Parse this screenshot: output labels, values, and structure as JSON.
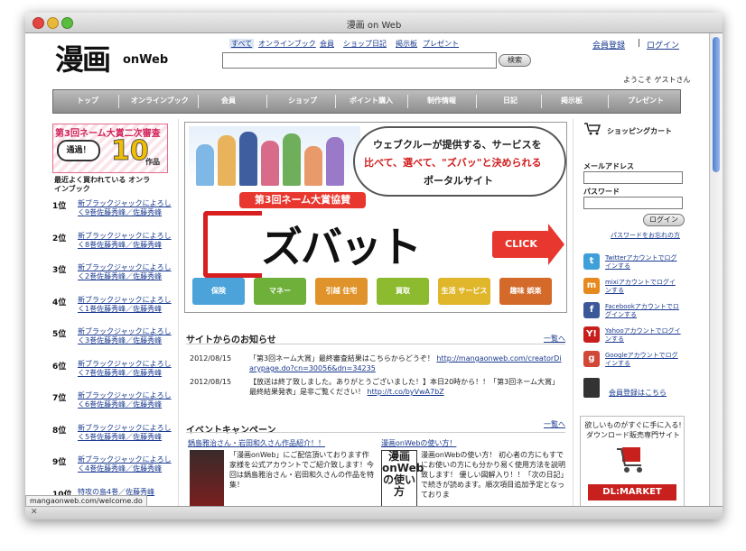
{
  "window": {
    "title": "漫画 on Web"
  },
  "status": {
    "url": "mangaonweb.com/welcome.do"
  },
  "header": {
    "logo_main": "漫画",
    "logo_sub": "onWeb",
    "search_tabs": [
      "すべて",
      "オンラインブック",
      "会員",
      "ショップ",
      "日記",
      "掲示板",
      "プレゼント"
    ],
    "search_button": "検索",
    "search_value": "",
    "member_register": "会員登録",
    "separator": "|",
    "login": "ログイン",
    "welcome": "ようこそ ゲストさん"
  },
  "nav": {
    "items": [
      "トップ",
      "オンラインブック",
      "会員",
      "ショップ",
      "ポイント購入",
      "制作情報",
      "日記",
      "掲示板",
      "プレゼント"
    ]
  },
  "left": {
    "contest_title": "第3回ネーム大賞二次審査",
    "pass_label": "通過！",
    "pass_count": "10",
    "pass_unit": "作品",
    "popular_label": "最近よく買われている オンラインブック",
    "ranking": [
      {
        "rank": "1位",
        "title": "新ブラックジャックによろしく9巻",
        "author": "佐藤秀峰／佐藤秀峰"
      },
      {
        "rank": "2位",
        "title": "新ブラックジャックによろしく8巻",
        "author": "佐藤秀峰／佐藤秀峰"
      },
      {
        "rank": "3位",
        "title": "新ブラックジャックによろしく2巻",
        "author": "佐藤秀峰／佐藤秀峰"
      },
      {
        "rank": "4位",
        "title": "新ブラックジャックによろしく1巻",
        "author": "佐藤秀峰／佐藤秀峰"
      },
      {
        "rank": "5位",
        "title": "新ブラックジャックによろしく3巻",
        "author": "佐藤秀峰／佐藤秀峰"
      },
      {
        "rank": "6位",
        "title": "新ブラックジャックによろしく7巻",
        "author": "佐藤秀峰／佐藤秀峰"
      },
      {
        "rank": "7位",
        "title": "新ブラックジャックによろしく6巻",
        "author": "佐藤秀峰／佐藤秀峰"
      },
      {
        "rank": "8位",
        "title": "新ブラックジャックによろしく5巻",
        "author": "佐藤秀峰／佐藤秀峰"
      },
      {
        "rank": "9位",
        "title": "新ブラックジャックによろしく4巻",
        "author": "佐藤秀峰／佐藤秀峰"
      },
      {
        "rank": "10位",
        "title": "特攻の島4巻／佐藤秀峰",
        "author": ""
      }
    ]
  },
  "banner": {
    "line1": "ウェブクルーが提供する、サービスを",
    "line2": "比べて、選べて、\"ズバッ\"と決められる",
    "line3": "ポータルサイト",
    "ribbon": "第3回ネーム大賞協賛",
    "logo": "ズバット",
    "click": "CLICK",
    "categories": [
      {
        "label": "保険",
        "color": "#4ba3d9"
      },
      {
        "label": "マネー",
        "color": "#6fb03b"
      },
      {
        "label": "引越 住宅",
        "color": "#e0932b"
      },
      {
        "label": "買取",
        "color": "#8dbb2f"
      },
      {
        "label": "生活 サービス",
        "color": "#e0b62b"
      },
      {
        "label": "趣味 娯楽",
        "color": "#d36a2a"
      }
    ]
  },
  "news": {
    "heading": "サイトからのお知らせ",
    "more": "一覧へ",
    "items": [
      {
        "date": "2012/08/15",
        "text": "「第3回ネーム大賞」最終審査結果はこちらからどうぞ！",
        "link": "http://mangaonweb.com/creatorDiarypage.do?cn=30056&dn=34235"
      },
      {
        "date": "2012/08/15",
        "text": "【放送は終了致しました。ありがとうございました！】本日20時から！！「第3回ネーム大賞」最終結果発表」是非ご覧ください！",
        "link": "http://t.co/byVwA7bZ"
      }
    ]
  },
  "events": {
    "heading": "イベントキャンペーン",
    "more": "一覧へ",
    "items": [
      {
        "title": "鍋島雅治さん・岩田和久さん作品紹介！！",
        "text": "「漫画onWeb」にご配信頂いております作家様を公式アカウントでご紹介致します！今回は鍋島雅治さん・岩田和久さんの作品を特集！"
      },
      {
        "title": "漫画onWebの使い方！",
        "text": "漫画onWebの使い方！ 初心者の方にもすでにお使いの方にも分かり易く使用方法を説明致します！ 優しい図解入り！！「次の日記」で続きが読めます。順次項目追加予定となっておりま"
      }
    ],
    "howto_image_text": "漫画onWebの使い方"
  },
  "right": {
    "cart_label": "ショッピングカート",
    "email_label": "メールアドレス",
    "password_label": "パスワード",
    "email_value": "",
    "password_value": "",
    "login_button": "ログイン",
    "forgot": "パスワードをお忘れの方",
    "social": [
      {
        "icon": "t",
        "color": "#3f9fd8",
        "label": "Twitterアカウントでログインする"
      },
      {
        "icon": "m",
        "color": "#e68a1f",
        "label": "mixiアカウントでログインする"
      },
      {
        "icon": "f",
        "color": "#3b5998",
        "label": "Facebookアカウントでログインする"
      },
      {
        "icon": "Y!",
        "color": "#c81e1e",
        "label": "Yahooアカウントでログインする"
      },
      {
        "icon": "g",
        "color": "#d14836",
        "label": "Googleアカウントでログインする"
      }
    ],
    "member_register": "会員登録はこちら",
    "ad_line1": "欲しいものがすぐに手に入る!",
    "ad_line2": "ダウンロード販売専門サイト",
    "ad_brand": "DL:MARKET"
  },
  "colors": {
    "accent_link": "#1a3a8f",
    "nav_gray": "#9a9a9a",
    "brand_red": "#e8372e"
  }
}
